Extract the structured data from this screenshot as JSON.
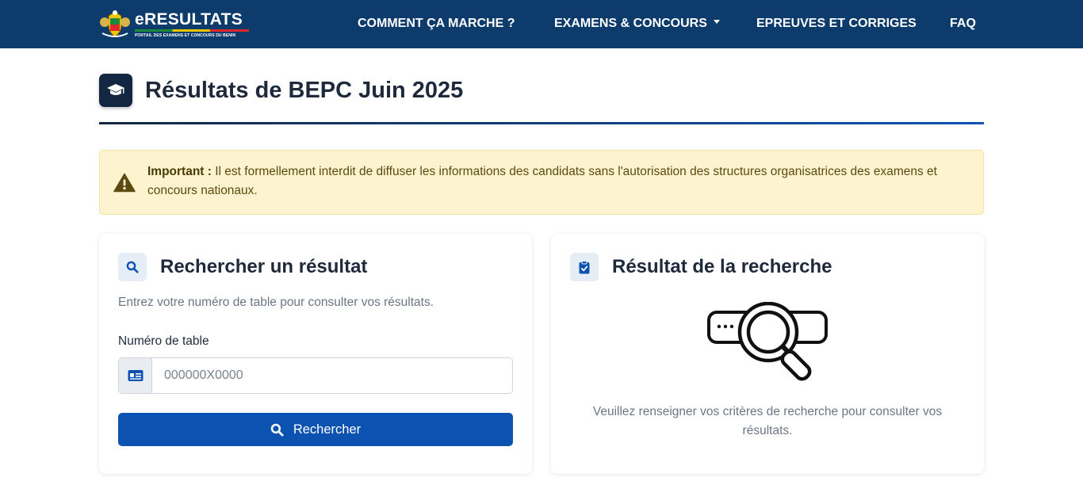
{
  "navbar": {
    "brand_name": "eRESULTATS",
    "brand_subtitle": "PORTAIL DES EXAMENS ET CONCOURS DU BENIN",
    "links": [
      {
        "label": "COMMENT ÇA MARCHE ?"
      },
      {
        "label": "EXAMENS & CONCOURS",
        "dropdown": true
      },
      {
        "label": "EPREUVES ET CORRIGES"
      },
      {
        "label": "FAQ"
      }
    ]
  },
  "header": {
    "title": "Résultats de BEPC Juin 2025",
    "icon": "graduation-cap-icon"
  },
  "alert": {
    "strong": "Important :",
    "text": " Il est formellement interdit de diffuser les informations des candidats sans l'autorisation des structures organisatrices des examens et concours nationaux.",
    "icon": "warning-icon"
  },
  "search_card": {
    "title": "Rechercher un résultat",
    "description": "Entrez votre numéro de table pour consulter vos résultats.",
    "field_label": "Numéro de table",
    "input_value": "",
    "input_placeholder": "000000X0000",
    "button_label": "Rechercher",
    "icon": "search-icon"
  },
  "result_card": {
    "title": "Résultat de la recherche",
    "message": "Veuillez renseigner vos critères de recherche pour consulter vos résultats.",
    "icon": "clipboard-check-icon"
  },
  "colors": {
    "navbar": "#0d3b6b",
    "primary": "#0c52b0",
    "dark": "#142742",
    "alert_bg": "#fdf3ce"
  }
}
